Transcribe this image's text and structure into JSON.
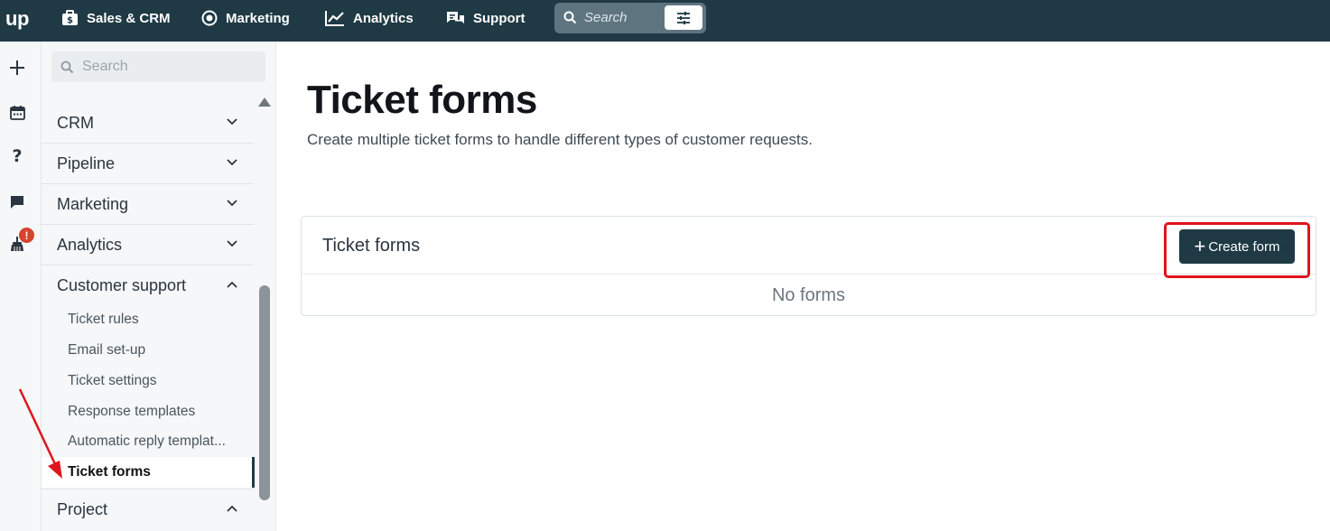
{
  "topbar": {
    "logo": "up",
    "nav": [
      {
        "label": "Sales & CRM",
        "icon": "briefcase-icon"
      },
      {
        "label": "Marketing",
        "icon": "target-icon"
      },
      {
        "label": "Analytics",
        "icon": "chart-line-icon"
      },
      {
        "label": "Support",
        "icon": "chat-bubbles-icon"
      }
    ],
    "search_placeholder": "Search"
  },
  "rail": {
    "icons": [
      "plus-icon",
      "calendar-icon",
      "help-icon",
      "chat-icon",
      "broom-icon"
    ],
    "alert_badge": "!"
  },
  "sidebar": {
    "search_placeholder": "Search",
    "sections": [
      {
        "label": "CRM",
        "expanded": false
      },
      {
        "label": "Pipeline",
        "expanded": false
      },
      {
        "label": "Marketing",
        "expanded": false
      },
      {
        "label": "Analytics",
        "expanded": false
      },
      {
        "label": "Customer support",
        "expanded": true
      },
      {
        "label": "Project",
        "expanded": true
      }
    ],
    "support_items": [
      {
        "label": "Ticket rules"
      },
      {
        "label": "Email set-up"
      },
      {
        "label": "Ticket settings"
      },
      {
        "label": "Response templates"
      },
      {
        "label": "Automatic reply templat..."
      },
      {
        "label": "Ticket forms",
        "active": true
      }
    ]
  },
  "main": {
    "title": "Ticket forms",
    "subtitle": "Create multiple ticket forms to handle different types of customer requests.",
    "card": {
      "title": "Ticket forms",
      "create_label": "Create form",
      "empty_text": "No forms"
    }
  },
  "colors": {
    "topbar": "#1f3a45",
    "accent": "#1f3a45",
    "annotation": "#e0141d",
    "badge": "#d6432f"
  }
}
